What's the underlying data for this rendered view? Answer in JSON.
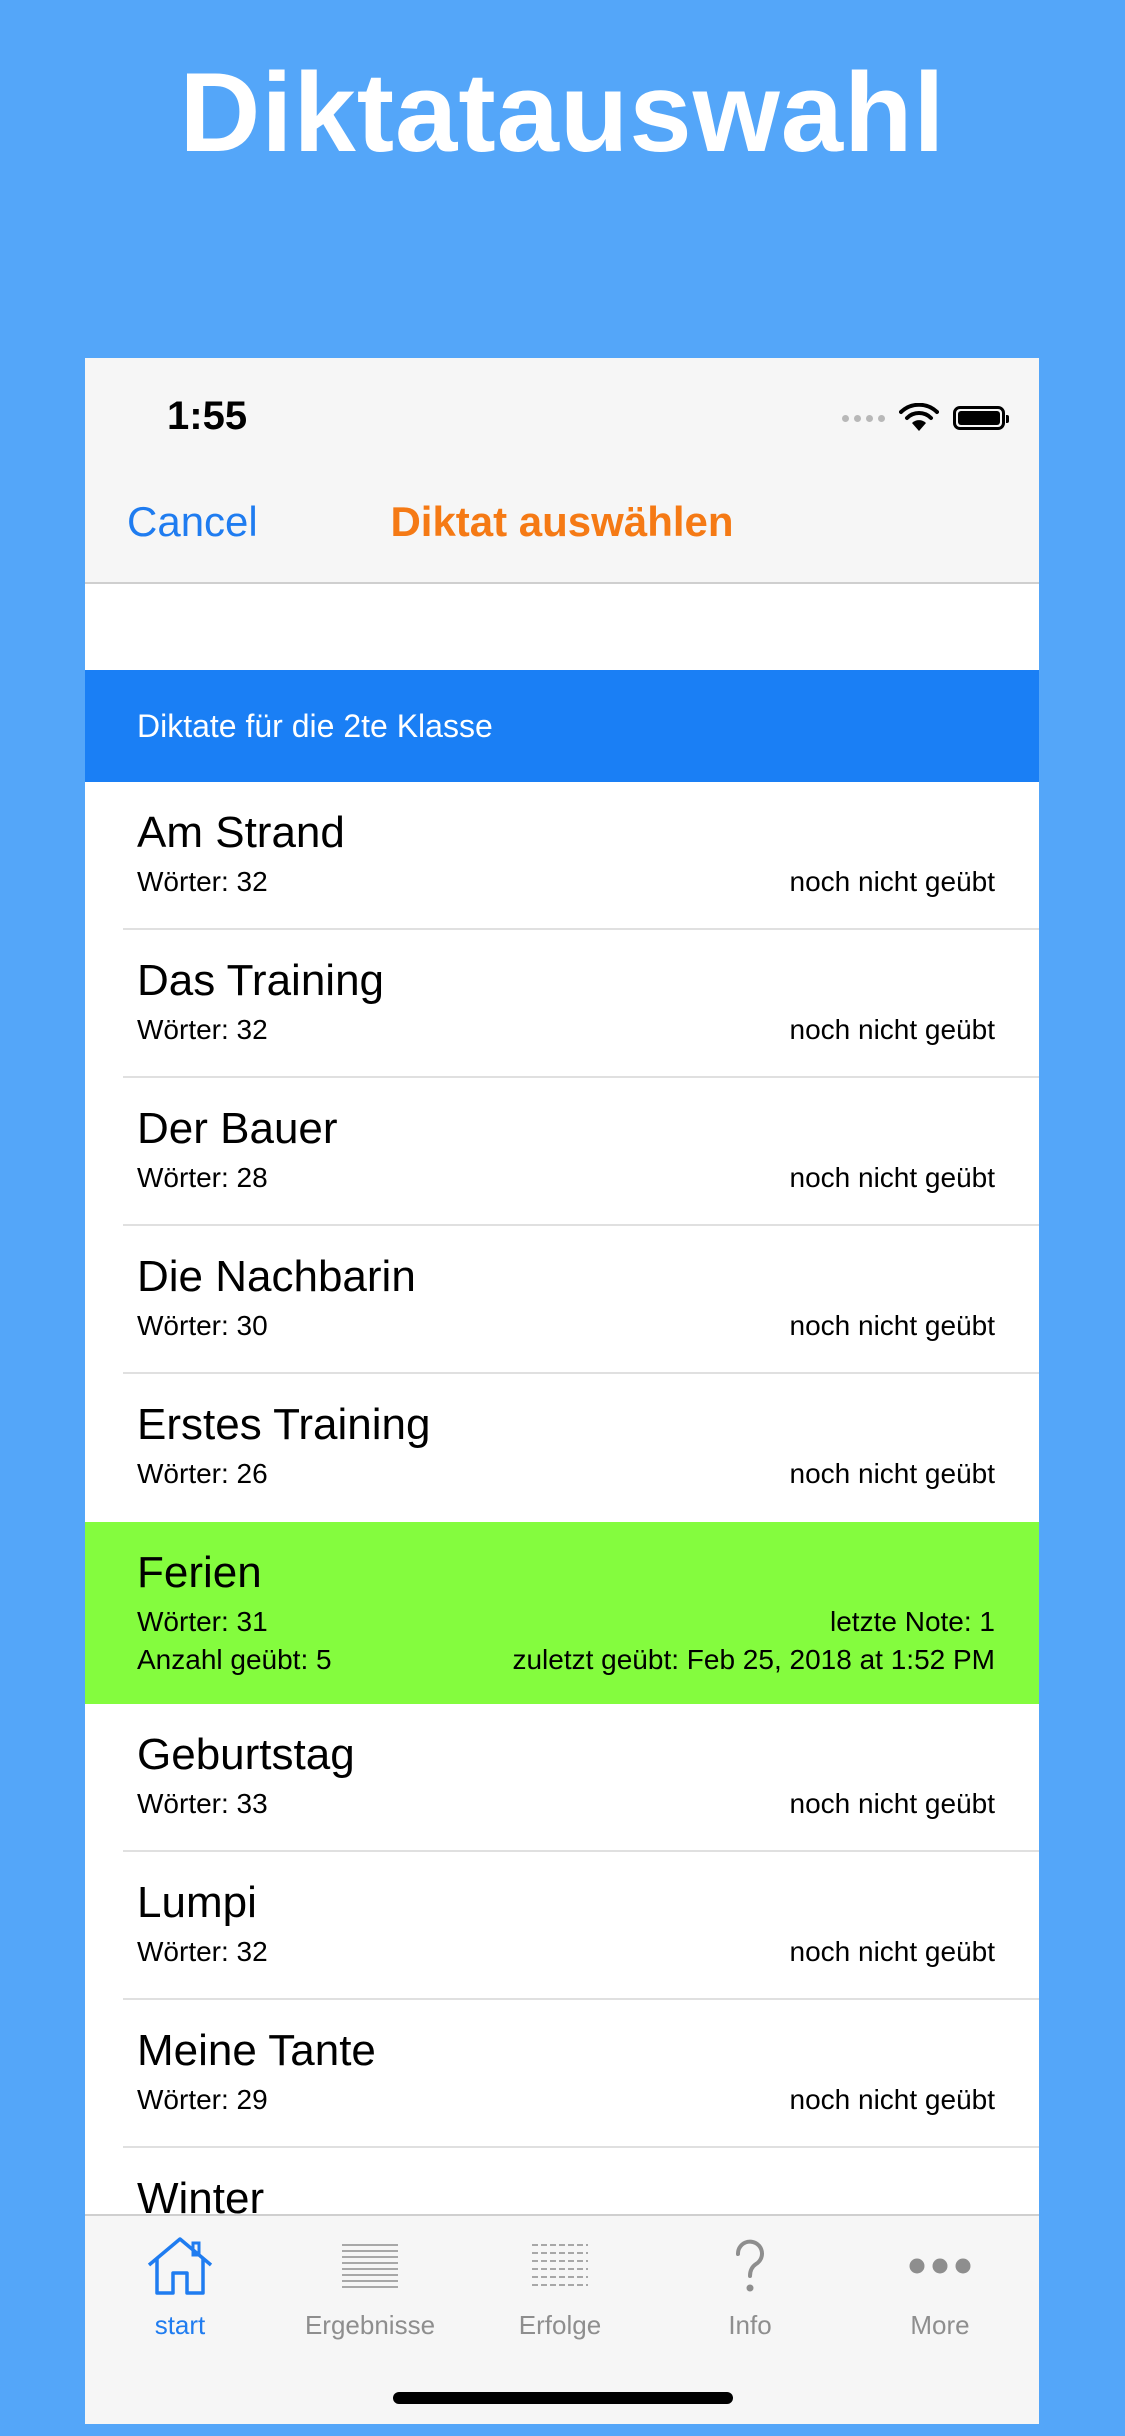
{
  "headline": "Diktatauswahl",
  "status_bar": {
    "time": "1:55"
  },
  "nav": {
    "cancel_label": "Cancel",
    "title": "Diktat auswählen"
  },
  "section": {
    "header": "Diktate für die 2te Klasse"
  },
  "colors": {
    "background": "#54a6f9",
    "accent": "#1f7cf0",
    "title": "#f57a15",
    "section": "#1a7ff5",
    "selected_row": "#84fc3e"
  },
  "rows": [
    {
      "title": "Am Strand",
      "words": "Wörter: 32",
      "status": "noch nicht geübt"
    },
    {
      "title": "Das Training",
      "words": "Wörter: 32",
      "status": "noch nicht geübt"
    },
    {
      "title": "Der Bauer",
      "words": "Wörter: 28",
      "status": "noch nicht geübt"
    },
    {
      "title": "Die Nachbarin",
      "words": "Wörter: 30",
      "status": "noch nicht geübt"
    },
    {
      "title": "Erstes Training",
      "words": "Wörter: 26",
      "status": "noch nicht geübt"
    },
    {
      "title": "Ferien",
      "words": "Wörter: 31",
      "status": "letzte Note: 1",
      "count": "Anzahl geübt: 5",
      "last_practiced": "zuletzt geübt: Feb 25, 2018 at 1:52 PM"
    },
    {
      "title": "Geburtstag",
      "words": "Wörter: 33",
      "status": "noch nicht geübt"
    },
    {
      "title": "Lumpi",
      "words": "Wörter: 32",
      "status": "noch nicht geübt"
    },
    {
      "title": "Meine Tante",
      "words": "Wörter: 29",
      "status": "noch nicht geübt"
    },
    {
      "title": "Winter"
    }
  ],
  "tabs": [
    {
      "label": "start",
      "icon": "house-icon"
    },
    {
      "label": "Ergebnisse",
      "icon": "list-lines-icon"
    },
    {
      "label": "Erfolge",
      "icon": "grid-icon"
    },
    {
      "label": "Info",
      "icon": "question-mark-icon"
    },
    {
      "label": "More",
      "icon": "more-dots-icon"
    }
  ]
}
